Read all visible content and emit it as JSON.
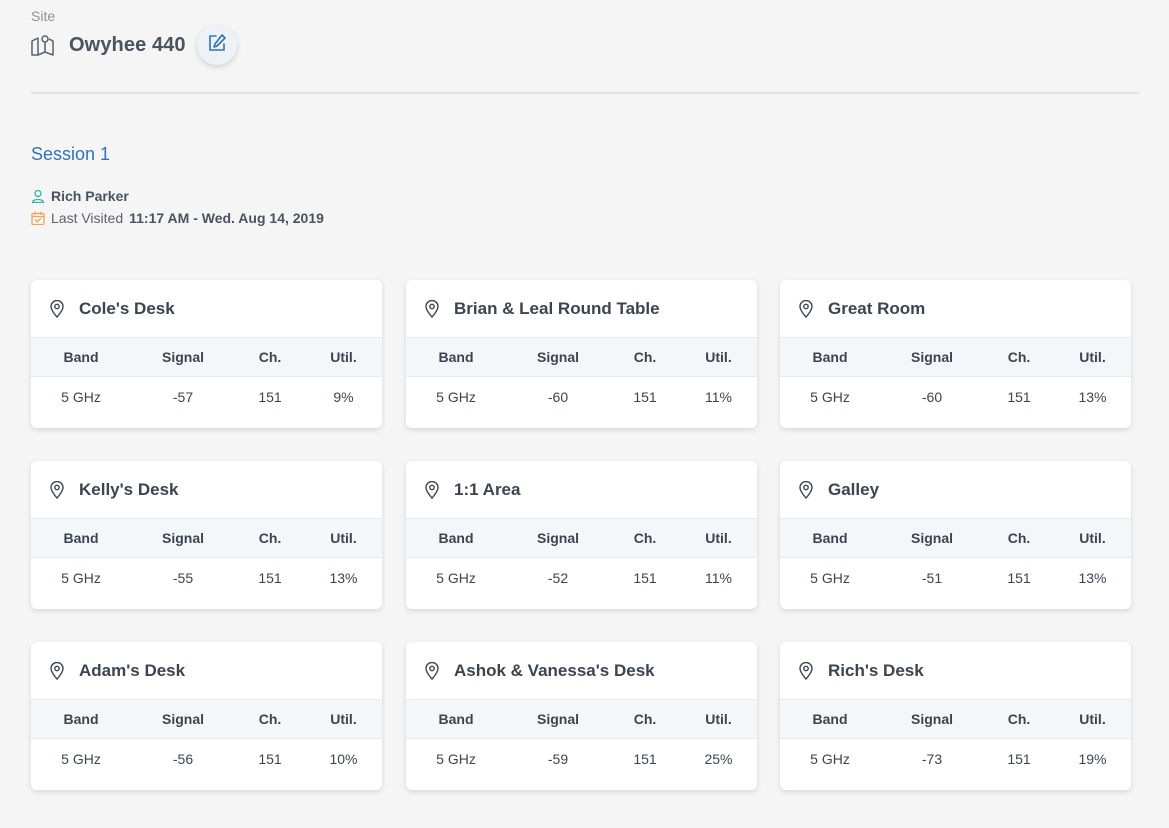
{
  "header": {
    "site_label": "Site",
    "site_name": "Owyhee 440",
    "icons": {
      "site": "map-icon",
      "edit": "edit-icon"
    }
  },
  "session": {
    "title": "Session 1",
    "user": "Rich Parker",
    "last_visited_label": "Last Visited",
    "last_visited_value": "11:17 AM - Wed. Aug 14, 2019",
    "colors": {
      "title": "#2f72b8",
      "user_icon": "#2fb7a6",
      "calendar_icon": "#f0a35a"
    }
  },
  "table_headers": {
    "band": "Band",
    "signal": "Signal",
    "ch": "Ch.",
    "util": "Util."
  },
  "locations": [
    {
      "name": "Cole's Desk",
      "band": "5 GHz",
      "signal": "-57",
      "ch": "151",
      "util": "9%"
    },
    {
      "name": "Brian & Leal Round Table",
      "band": "5 GHz",
      "signal": "-60",
      "ch": "151",
      "util": "11%"
    },
    {
      "name": "Great Room",
      "band": "5 GHz",
      "signal": "-60",
      "ch": "151",
      "util": "13%"
    },
    {
      "name": "Kelly's Desk",
      "band": "5 GHz",
      "signal": "-55",
      "ch": "151",
      "util": "13%"
    },
    {
      "name": "1:1 Area",
      "band": "5 GHz",
      "signal": "-52",
      "ch": "151",
      "util": "11%"
    },
    {
      "name": "Galley",
      "band": "5 GHz",
      "signal": "-51",
      "ch": "151",
      "util": "13%"
    },
    {
      "name": "Adam's Desk",
      "band": "5 GHz",
      "signal": "-56",
      "ch": "151",
      "util": "10%"
    },
    {
      "name": "Ashok & Vanessa's Desk",
      "band": "5 GHz",
      "signal": "-59",
      "ch": "151",
      "util": "25%"
    },
    {
      "name": "Rich's Desk",
      "band": "5 GHz",
      "signal": "-73",
      "ch": "151",
      "util": "19%"
    }
  ]
}
